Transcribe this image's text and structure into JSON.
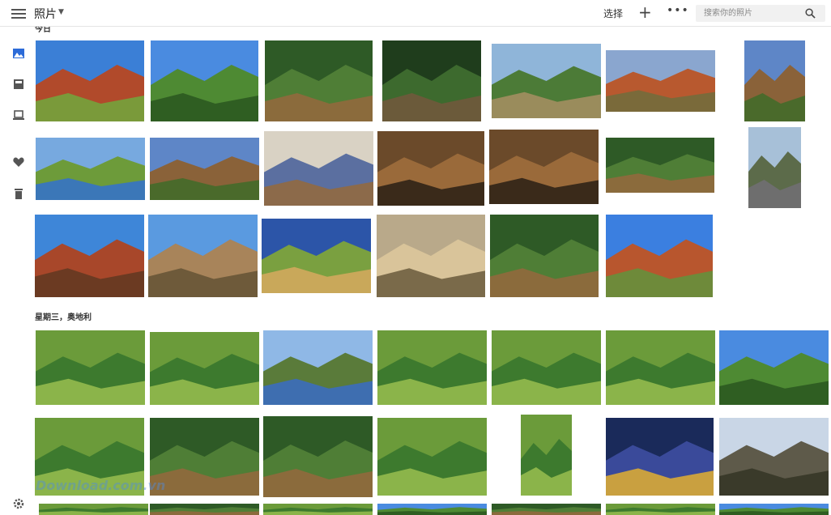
{
  "header": {
    "title": "照片",
    "select_label": "选择",
    "search_placeholder": "搜索你的照片"
  },
  "sections": [
    {
      "label": "今日"
    },
    {
      "label": "星期三，奥地利"
    }
  ],
  "watermark": "Download.com.vn",
  "colors": {
    "accent": "#2c6bd8",
    "icon": "#555555"
  }
}
